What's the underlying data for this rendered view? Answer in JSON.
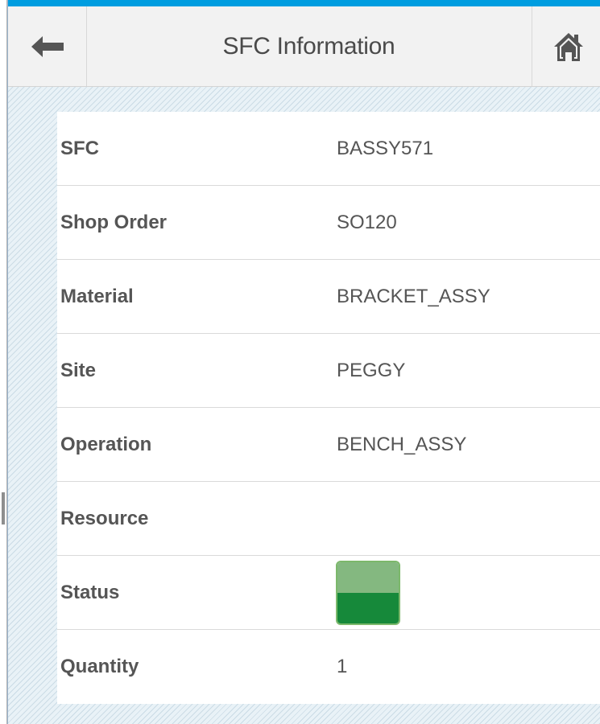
{
  "header": {
    "title": "SFC Information",
    "back_icon": "arrow-left-icon",
    "home_icon": "home-icon",
    "accent_color": "#009de0"
  },
  "fields": [
    {
      "label": "SFC",
      "value": "BASSY571"
    },
    {
      "label": "Shop Order",
      "value": "SO120"
    },
    {
      "label": "Material",
      "value": "BRACKET_ASSY"
    },
    {
      "label": "Site",
      "value": "PEGGY"
    },
    {
      "label": "Operation",
      "value": "BENCH_ASSY"
    },
    {
      "label": "Resource",
      "value": ""
    },
    {
      "label": "Status",
      "icon": "status-green-icon",
      "color": "#16893a"
    },
    {
      "label": "Quantity",
      "value": "1"
    }
  ]
}
